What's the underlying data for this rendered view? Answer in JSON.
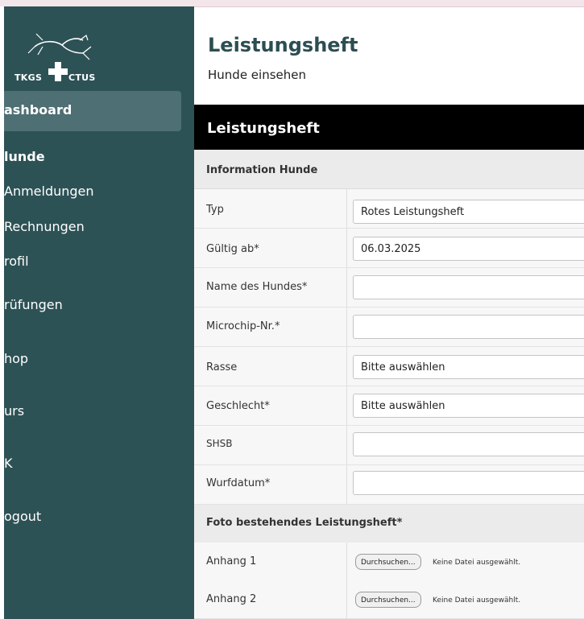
{
  "logo": {
    "text_left": "TKGS",
    "text_right": "CTUS"
  },
  "sidebar": {
    "items": [
      {
        "label": "ashboard",
        "active": true
      },
      {
        "label": "lunde",
        "bold": true
      },
      {
        "label": "Anmeldungen"
      },
      {
        "label": "Rechnungen"
      },
      {
        "label": "rofil"
      },
      {
        "label": "rüfungen"
      },
      {
        "label": "hop"
      },
      {
        "label": "urs"
      },
      {
        "label": "K"
      },
      {
        "label": "ogout"
      }
    ]
  },
  "header": {
    "title": "Leistungsheft",
    "subtitle": "Hunde einsehen"
  },
  "panel": {
    "title": "Leistungsheft"
  },
  "form": {
    "section_info": "Information Hunde",
    "fields": [
      {
        "label": "Typ",
        "value": "Rotes Leistungsheft"
      },
      {
        "label": "Gültig ab*",
        "value": "06.03.2025"
      },
      {
        "label": "Name des Hundes*",
        "value": ""
      },
      {
        "label": "Microchip-Nr.*",
        "value": ""
      },
      {
        "label": "Rasse",
        "value": "Bitte auswählen"
      },
      {
        "label": "Geschlecht*",
        "value": "Bitte auswählen"
      },
      {
        "label": "SHSB",
        "value": ""
      },
      {
        "label": "Wurfdatum*",
        "value": ""
      }
    ],
    "section_photo": "Foto bestehendes Leistungsheft*",
    "attachments": [
      {
        "label": "Anhang 1",
        "button": "Durchsuchen...",
        "status": "Keine Datei ausgewählt."
      },
      {
        "label": "Anhang 2",
        "button": "Durchsuchen...",
        "status": "Keine Datei ausgewählt."
      }
    ]
  },
  "colors": {
    "sidebar": "#2d5256",
    "active_item": "#4e6f73",
    "title": "#2c4e52"
  }
}
